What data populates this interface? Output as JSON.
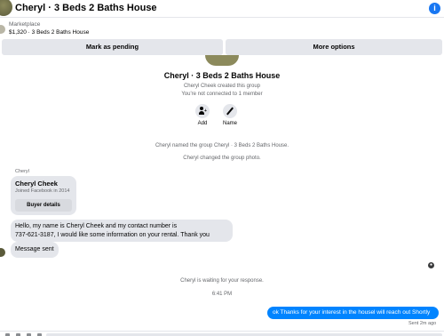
{
  "header": {
    "title": "Cheryl · 3 Beds 2 Baths House",
    "info_icon": "info-icon"
  },
  "listing": {
    "kind": "Marketplace",
    "summary": "$1,320 · 3 Beds 2 Baths House"
  },
  "actions": {
    "pending_label": "Mark as pending",
    "more_label": "More options"
  },
  "group": {
    "name": "Cheryl · 3 Beds 2 Baths House",
    "created": "Cheryl Cheek created this group",
    "connection": "You're not connected to 1 member",
    "add_label": "Add",
    "name_label": "Name"
  },
  "system_messages": {
    "renamed": "Cheryl named the group Cheryl · 3 Beds 2 Baths House.",
    "photo": "Cheryl changed the group photo.",
    "waiting": "Cheryl is waiting for your response.",
    "time": "6:41 PM"
  },
  "thread": {
    "sender": "Cheryl",
    "profile_name": "Cheryl Cheek",
    "profile_joined": "Joined Facebook in 2014",
    "buyer_details_label": "Buyer details",
    "message_1_line_1": "Hello, my name is Cheryl Cheek and my contact number is",
    "message_1_line_2": "737-621-3187, I would like some information on your rental.  Thank you",
    "message_2": "Message sent",
    "reply": "ok Thanks for your interest in the housel will reach out Shortly",
    "sent_status": "Sent 2m ago"
  },
  "colors": {
    "accent": "#0084ff",
    "bubble_gray": "#e4e6eb",
    "muted_text": "#65676b"
  }
}
